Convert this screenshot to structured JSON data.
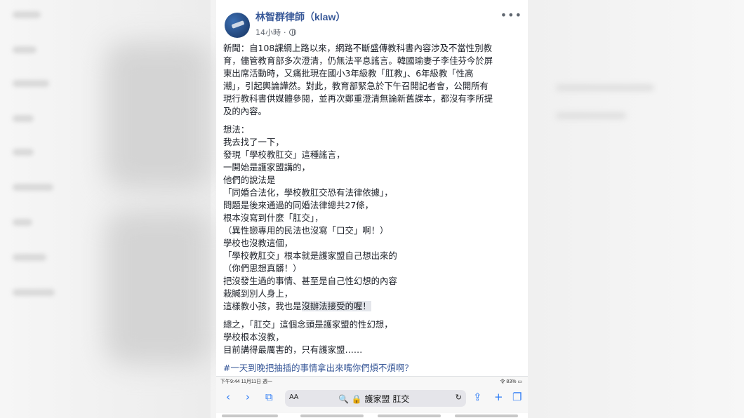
{
  "post": {
    "author": "林智群律師（klaw）",
    "time": "14小時",
    "separator": "·",
    "more_label": "•••",
    "news": [
      "新聞：自108課綱上路以來，網路不斷盛傳教科書內容涉及不當性別教",
      "育，儘管教育部多次澄清，仍無法平息謠言。韓國瑜妻子李佳芬今於屏",
      "東出席活動時，又痛批現在國小3年級教「肛教」、6年級教「性高",
      "潮」，引起輿論譁然。對此，教育部緊急於下午召開記者會，公開所有",
      "現行教科書供媒體參閱，並再次鄭重澄清無論新舊課本，都沒有李所提",
      "及的內容。"
    ],
    "thoughts_before": [
      "想法：",
      "我去找了一下，",
      "發現「學校教肛交」這種謠言，",
      "一開始是護家盟講的，",
      "他們的說法是",
      "「同婚合法化，學校教肛交恐有法律依據」，",
      "問題是後來通過的同婚法律總共27條，",
      "根本沒寫到什麼「肛交」，",
      "（異性戀專用的民法也沒寫「口交」啊！）",
      "學校也沒教這個，",
      "「學校教肛交」根本就是護家盟自己想出來的",
      "（你們思想真髒！）",
      "把沒發生過的事情、甚至是自己性幻想的內容",
      "栽贓到別人身上，"
    ],
    "highlight_line_plain": "這樣教小孩，我也是",
    "highlight_line_marked": "沒辦法接受的喔！",
    "conclusion": [
      "總之，「肛交」這個念頭是護家盟的性幻想，",
      "學校根本沒教，",
      "目前講得最厲害的，只有護家盟……"
    ],
    "hashtag": "#一天到晚把抽插的事情拿出來嘴你們煩不煩啊？"
  },
  "phone": {
    "status_left": "下午9:44  11月11日 週一",
    "status_right": "令 83% ▭",
    "url_aa": "AA",
    "url_text": "🔍 🔒 護家盟 肛交",
    "icons": {
      "back": "‹",
      "forward": "›",
      "bookmarks": "⧉",
      "reload": "↻",
      "share": "⇪",
      "add": "+",
      "tabs": "❐"
    }
  },
  "colors": {
    "link": "#385898",
    "text": "#1d2129",
    "meta": "#616770",
    "safari_blue": "#2e7cf6"
  }
}
